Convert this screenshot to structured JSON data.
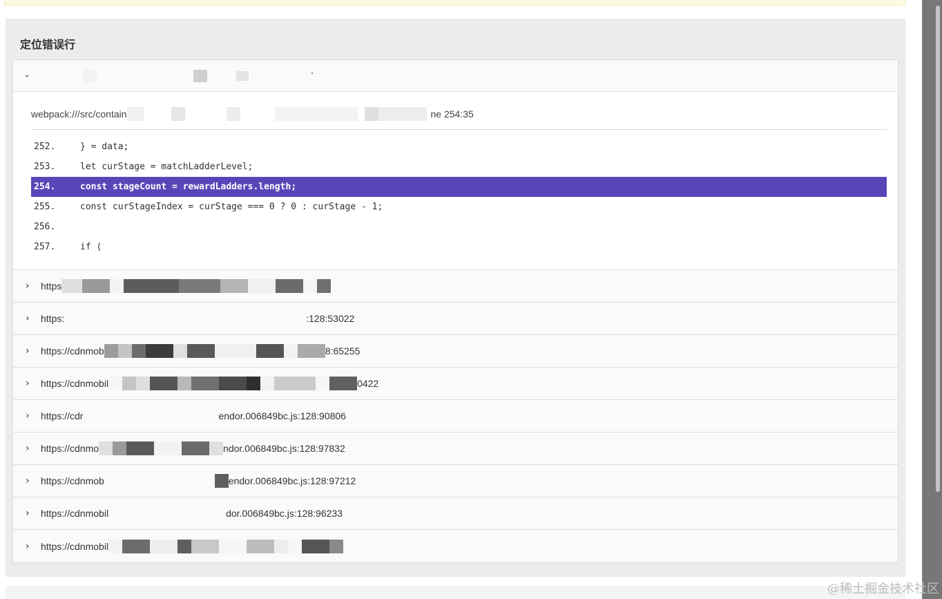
{
  "panel": {
    "title": "定位错误行"
  },
  "top_row": {
    "text": "`"
  },
  "file_path": {
    "prefix": "webpack:///src/contain",
    "suffix": "ne 254:35"
  },
  "code_lines": [
    {
      "num": "252.",
      "code": "} = data;"
    },
    {
      "num": "253.",
      "code": "let curStage = matchLadderLevel;"
    },
    {
      "num": "254.",
      "code": "const stageCount = rewardLadders.length;"
    },
    {
      "num": "255.",
      "code": "const curStageIndex = curStage === 0 ? 0 : curStage - 1;"
    },
    {
      "num": "256.",
      "code": ""
    },
    {
      "num": "257.",
      "code": "if ("
    }
  ],
  "frames": [
    {
      "prefix": "https",
      "suffix": ""
    },
    {
      "prefix": "https:",
      "suffix": ":128:53022"
    },
    {
      "prefix": "https://cdnmob",
      "suffix": "8:65255"
    },
    {
      "prefix": "https://cdnmobil",
      "suffix": "0422"
    },
    {
      "prefix": "https://cdr",
      "suffix": "endor.006849bc.js:128:90806"
    },
    {
      "prefix": "https://cdnmo",
      "suffix": "ndor.006849bc.js:128:97832"
    },
    {
      "prefix": "https://cdnmob",
      "suffix": "endor.006849bc.js:128:97212"
    },
    {
      "prefix": "https://cdnmobil",
      "suffix": "dor.006849bc.js:128:96233"
    },
    {
      "prefix": "https://cdnmobil",
      "suffix": ""
    }
  ],
  "icons": {
    "collapsed": "chevron-right-icon",
    "expanded": "chevron-down-icon"
  },
  "watermark": "@稀土掘金技术社区",
  "colors": {
    "highlight": "#5a45b8",
    "panel_bg": "#ececec"
  }
}
